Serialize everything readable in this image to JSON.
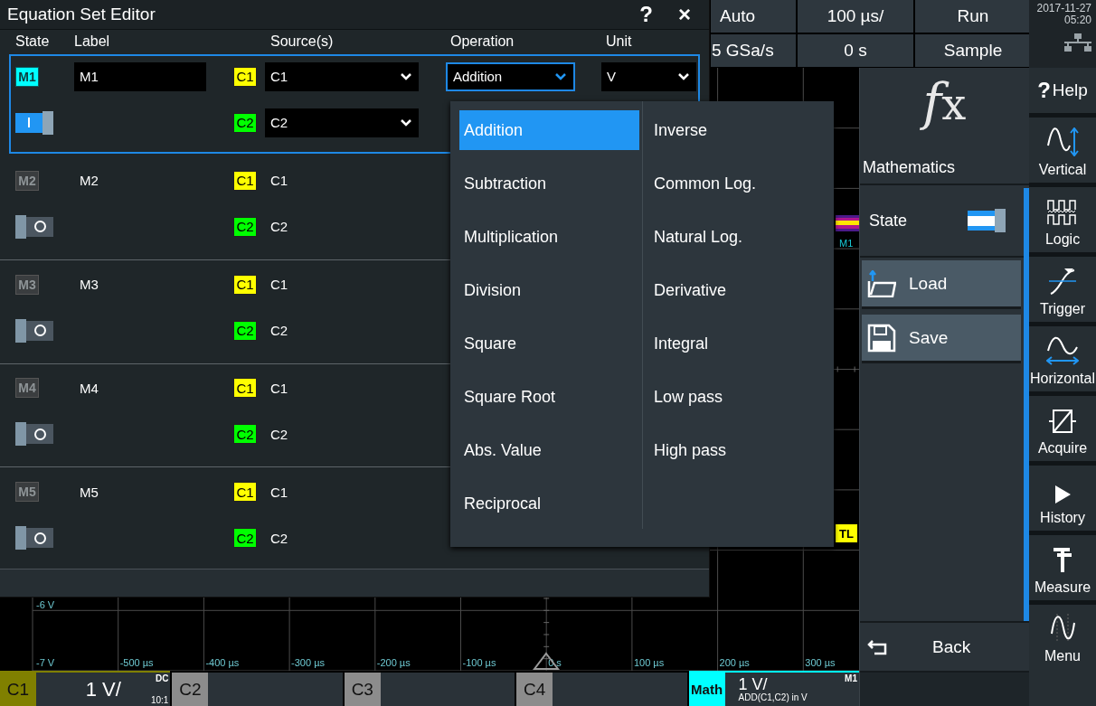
{
  "status_header": {
    "cells": [
      {
        "label": "Auto"
      },
      {
        "label": "100 µs/"
      },
      {
        "label": "Run"
      },
      {
        "label": "5 GSa/s"
      },
      {
        "label": "0 s"
      },
      {
        "label": "Sample"
      }
    ],
    "date": "2017-11-27",
    "time": "05:20"
  },
  "dialog": {
    "title": "Equation Set Editor",
    "help": "?",
    "close": "×",
    "columns": [
      "State",
      "Label",
      "Source(s)",
      "Operation",
      "Unit"
    ],
    "equations": [
      {
        "badge": "M1",
        "on": true,
        "selected": true,
        "label": "M1",
        "sources": [
          {
            "badge": "C1",
            "color": "#ffff00",
            "value": "C1"
          },
          {
            "badge": "C2",
            "color": "#00ff00",
            "value": "C2"
          }
        ],
        "operation": {
          "value": "Addition",
          "open": true
        },
        "unit": {
          "value": "V"
        }
      },
      {
        "badge": "M2",
        "on": false,
        "selected": false,
        "label": "M2",
        "sources": [
          {
            "badge": "C1",
            "color": "#ffff00",
            "value": "C1"
          },
          {
            "badge": "C2",
            "color": "#00ff00",
            "value": "C2"
          }
        ]
      },
      {
        "badge": "M3",
        "on": false,
        "selected": false,
        "label": "M3",
        "sources": [
          {
            "badge": "C1",
            "color": "#ffff00",
            "value": "C1"
          },
          {
            "badge": "C2",
            "color": "#00ff00",
            "value": "C2"
          }
        ]
      },
      {
        "badge": "M4",
        "on": false,
        "selected": false,
        "label": "M4",
        "sources": [
          {
            "badge": "C1",
            "color": "#ffff00",
            "value": "C1"
          },
          {
            "badge": "C2",
            "color": "#00ff00",
            "value": "C2"
          }
        ]
      },
      {
        "badge": "M5",
        "on": false,
        "selected": false,
        "label": "M5",
        "sources": [
          {
            "badge": "C1",
            "color": "#ffff00",
            "value": "C1"
          },
          {
            "badge": "C2",
            "color": "#00ff00",
            "value": "C2"
          }
        ]
      }
    ]
  },
  "operation_menu": {
    "columns": [
      {
        "items": [
          {
            "label": "Addition",
            "selected": true
          },
          {
            "label": "Subtraction",
            "selected": false
          },
          {
            "label": "Multiplication",
            "selected": false
          },
          {
            "label": "Division",
            "selected": false
          },
          {
            "label": "Square",
            "selected": false
          },
          {
            "label": "Square Root",
            "selected": false
          },
          {
            "label": "Abs. Value",
            "selected": false
          },
          {
            "label": "Reciprocal",
            "selected": false
          }
        ]
      },
      {
        "items": [
          {
            "label": "Inverse",
            "selected": false
          },
          {
            "label": "Common Log.",
            "selected": false
          },
          {
            "label": "Natural Log.",
            "selected": false
          },
          {
            "label": "Derivative",
            "selected": false
          },
          {
            "label": "Integral",
            "selected": false
          },
          {
            "label": "Low pass",
            "selected": false
          },
          {
            "label": "High pass",
            "selected": false
          }
        ]
      }
    ]
  },
  "scope": {
    "y_labels": [
      "-6 V",
      "-7 V"
    ],
    "x_labels": [
      "-500 µs",
      "-400 µs",
      "-300 µs",
      "-200 µs",
      "-100 µs",
      "0 s",
      "100 µs",
      "200 µs",
      "300 µs"
    ],
    "trace_label": "M1",
    "trigger_level": "TL"
  },
  "math_panel": {
    "icon": [
      "f",
      "x"
    ],
    "title": "Mathematics",
    "state_label": "State",
    "state_on": true,
    "buttons": [
      {
        "kind": "load",
        "label": "Load"
      },
      {
        "kind": "save",
        "label": "Save"
      }
    ],
    "back": "Back"
  },
  "sidebar": [
    {
      "kind": "help",
      "glyph": "?",
      "label": "Help"
    },
    {
      "kind": "vertical",
      "label": "Vertical"
    },
    {
      "kind": "logic",
      "label": "Logic"
    },
    {
      "kind": "trigger",
      "label": "Trigger"
    },
    {
      "kind": "horizontal",
      "label": "Horizontal"
    },
    {
      "kind": "acquire",
      "label": "Acquire"
    },
    {
      "kind": "history",
      "label": "History"
    },
    {
      "kind": "measure",
      "label": "Measure"
    },
    {
      "kind": "menu",
      "label": "Menu"
    }
  ],
  "channel_bar": [
    {
      "kind": "channel",
      "name": "C1",
      "color": "#808000",
      "active": true,
      "scale": "1 V/",
      "coupling": "DC",
      "probe": "10:1"
    },
    {
      "kind": "channel",
      "name": "C2",
      "color": "#8c8c8c",
      "active": false
    },
    {
      "kind": "channel",
      "name": "C3",
      "color": "#8c8c8c",
      "active": false
    },
    {
      "kind": "channel",
      "name": "C4",
      "color": "#8c8c8c",
      "active": false
    },
    {
      "kind": "math",
      "name": "Math",
      "color": "#00ffff",
      "active": true,
      "scale": "1 V/",
      "expression": "ADD(C1,C2) in V",
      "source": "M1"
    }
  ]
}
